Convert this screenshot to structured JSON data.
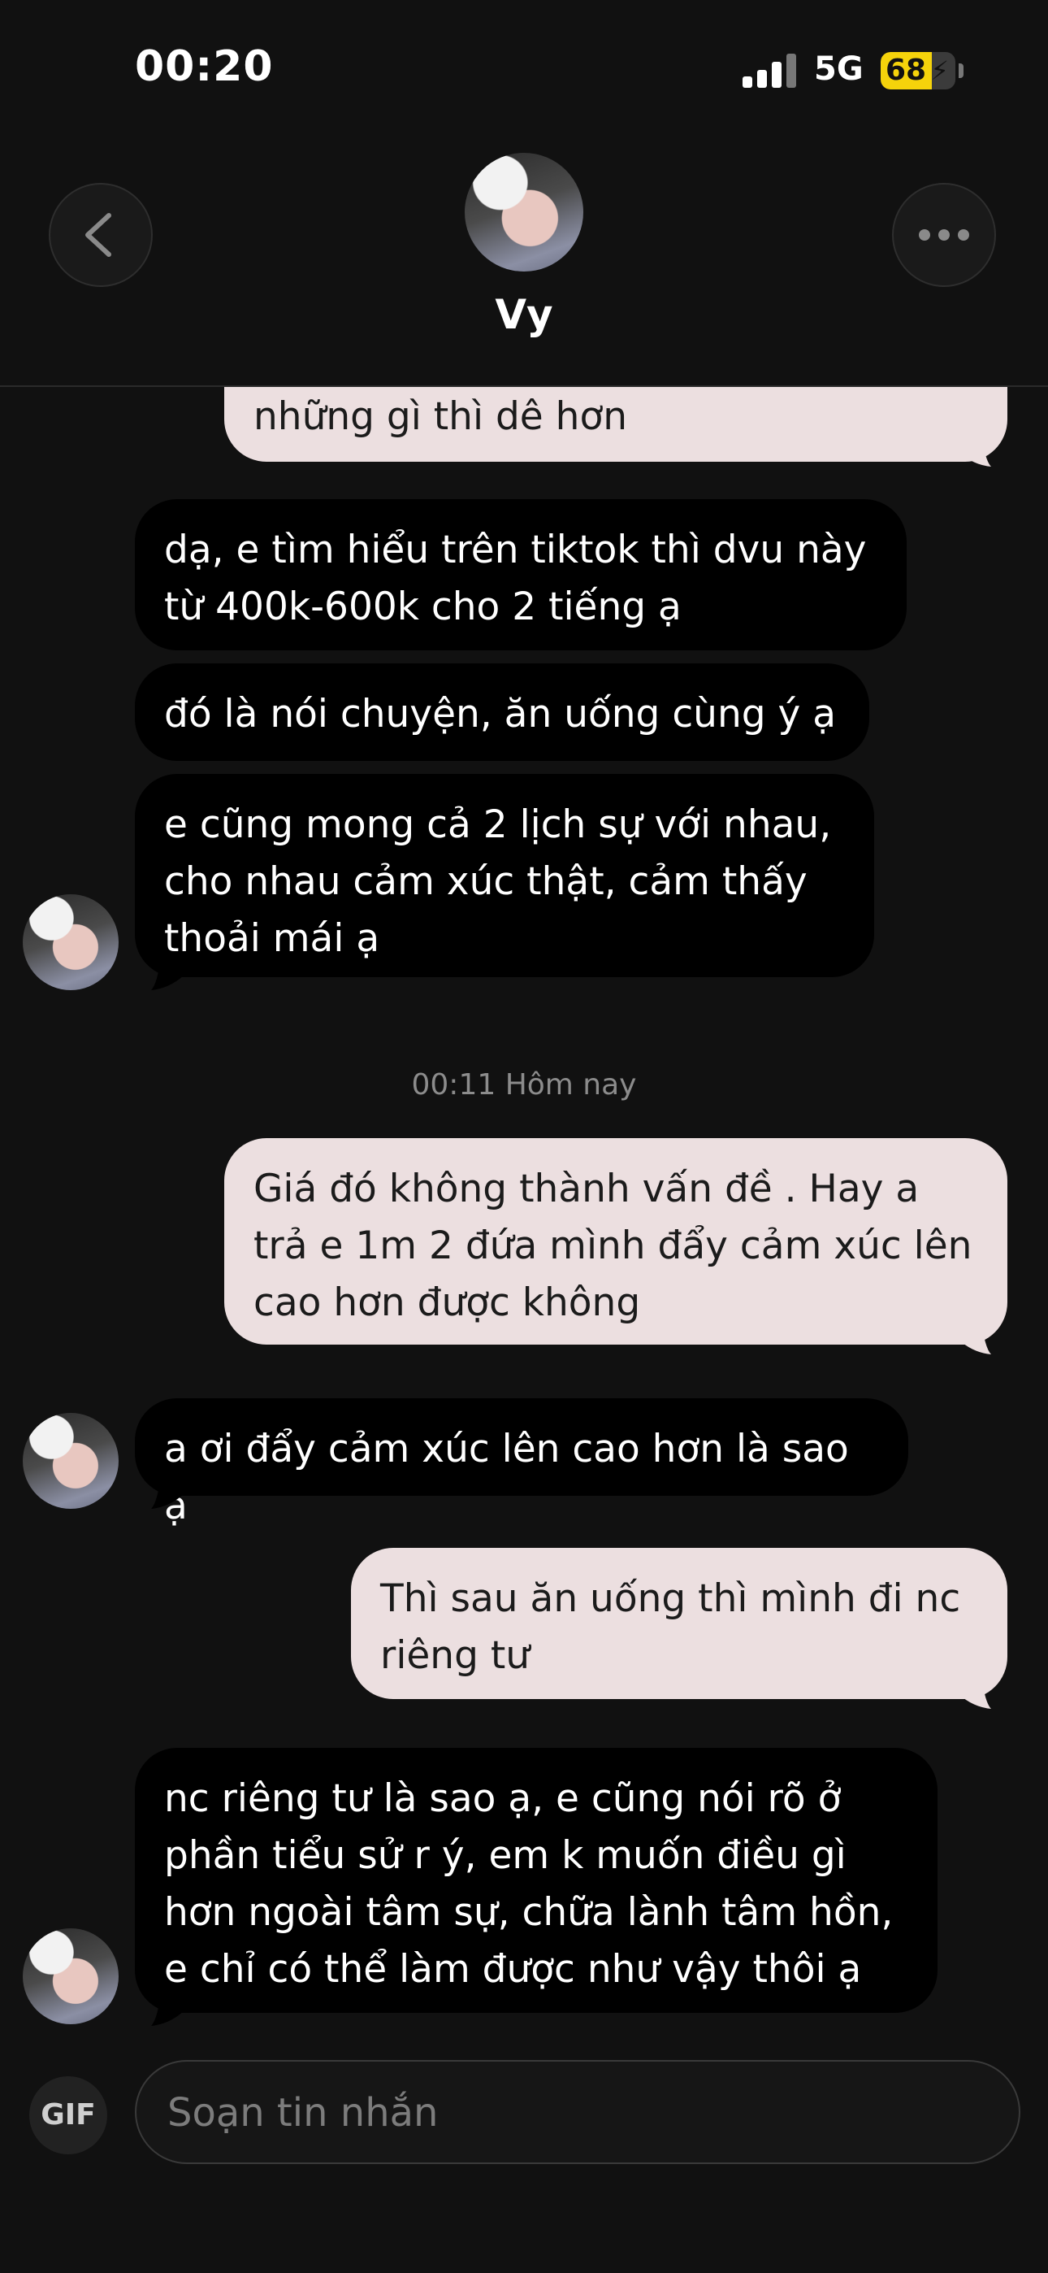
{
  "status_bar": {
    "time": "00:20",
    "network": "5G",
    "battery": "68",
    "battery_level": 0.68
  },
  "header": {
    "contact_name": "Vy",
    "back_icon": "chevron-left-icon",
    "more_icon": "ellipsis-icon"
  },
  "messages": [
    {
      "from": "me",
      "text": "những gì thì dê hơn"
    },
    {
      "from": "them",
      "text": "dạ, e tìm hiểu trên tiktok thì dvu này từ 400k-600k cho 2 tiếng ạ"
    },
    {
      "from": "them",
      "text": "đó là nói chuyện, ăn uống cùng ý ạ"
    },
    {
      "from": "them",
      "text": "e cũng mong cả 2 lịch sự với nhau, cho nhau cảm xúc thật, cảm thấy thoải mái ạ"
    },
    {
      "from": "me",
      "text": "Giá đó không thành vấn đề . Hay a trả e 1m 2 đứa mình đẩy cảm xúc lên cao hơn được không"
    },
    {
      "from": "them",
      "text": "a ơi đẩy cảm xúc lên cao hơn là sao ạ"
    },
    {
      "from": "me",
      "text": "Thì sau ăn uống thì mình đi nc riêng tư"
    },
    {
      "from": "them",
      "text": "nc riêng tư là sao ạ, e cũng nói rõ ở phần tiểu sử r ý, em k muốn điều gì hơn ngoài tâm sự, chữa lành tâm hồn, e chỉ có thể làm được như vậy thôi ạ"
    }
  ],
  "timestamp": "00:11 Hôm nay",
  "composer": {
    "gif_label": "GIF",
    "placeholder": "Soạn tin nhắn"
  },
  "colors": {
    "background": "#111111",
    "incoming_bubble": "#000000",
    "outgoing_bubble": "#ecdfe0",
    "battery": "#f5d30b"
  }
}
